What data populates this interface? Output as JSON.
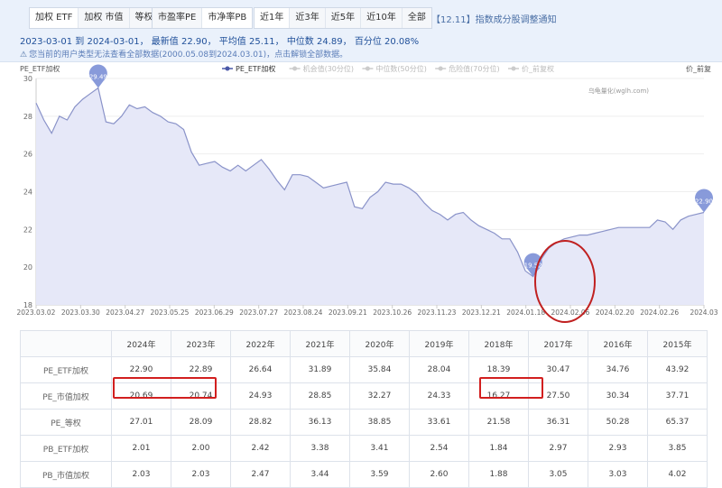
{
  "toolbar": {
    "group1": [
      "加权 ETF",
      "加权 市值",
      "等权"
    ],
    "group2": [
      "市盈率PE",
      "市净率PB"
    ],
    "group3": [
      "近1年",
      "近3年",
      "近5年",
      "近10年",
      "全部"
    ],
    "notice": "【12.11】指数成分股调整通知"
  },
  "info": {
    "range": "2023-03-01 到 2024-03-01",
    "latest_label": "最新值",
    "latest": "22.90",
    "avg_label": "平均值",
    "avg": "25.11",
    "median_label": "中位数",
    "median": "24.89",
    "pct_label": "百分位",
    "pct": "20.08%"
  },
  "warning": "您当前的用户类型无法查看全部数据(2000.05.08到2024.03.01)，点击解锁全部数据。",
  "chart_data": {
    "type": "area",
    "ylabel_left": "PE_ETF加权",
    "ylabel_right": "价_前复",
    "watermark": "乌龟量化(wglh.com)",
    "legend": [
      "PE_ETF加权",
      "机会值(30分位)",
      "中位数(50分位)",
      "危险值(70分位)",
      "价_前复权"
    ],
    "y_ticks": [
      "30",
      "28",
      "26",
      "24",
      "22",
      "20",
      "18"
    ],
    "ylim": [
      18,
      30
    ],
    "x_labels": [
      "2023.03.02",
      "2023.03.30",
      "2023.04.27",
      "2023.05.25",
      "2023.06.29",
      "2023.07.27",
      "2023.08.24",
      "2023.09.21",
      "2023.10.26",
      "2023.11.23",
      "2023.12.21",
      "2024.01.18",
      "2024.02.06",
      "2024.02.20",
      "2024.02.26",
      "2024.03"
    ],
    "values": [
      28.7,
      27.8,
      27.1,
      28.0,
      27.8,
      28.5,
      28.9,
      29.2,
      29.5,
      27.7,
      27.6,
      28.0,
      28.6,
      28.4,
      28.5,
      28.2,
      28.0,
      27.7,
      27.6,
      27.3,
      26.1,
      25.4,
      25.5,
      25.6,
      25.3,
      25.1,
      25.4,
      25.1,
      25.4,
      25.7,
      25.2,
      24.6,
      24.1,
      24.9,
      24.9,
      24.8,
      24.5,
      24.2,
      24.3,
      24.4,
      24.5,
      23.2,
      23.1,
      23.7,
      24.0,
      24.5,
      24.4,
      24.4,
      24.2,
      23.9,
      23.4,
      23.0,
      22.8,
      22.5,
      22.8,
      22.9,
      22.5,
      22.2,
      22.0,
      21.8,
      21.5,
      21.5,
      20.8,
      19.8,
      19.5,
      20.4,
      21.0,
      21.3,
      21.5,
      21.6,
      21.7,
      21.7,
      21.8,
      21.9,
      22.0,
      22.1,
      22.1,
      22.1,
      22.1,
      22.1,
      22.5,
      22.4,
      22.0,
      22.5,
      22.7,
      22.8,
      22.9
    ],
    "markers": [
      {
        "label": "29.49",
        "index": 8
      },
      {
        "label": "19.52",
        "index": 64
      },
      {
        "label": "22.90",
        "index": 86
      }
    ]
  },
  "table": {
    "headers": [
      "",
      "2024年",
      "2023年",
      "2022年",
      "2021年",
      "2020年",
      "2019年",
      "2018年",
      "2017年",
      "2016年",
      "2015年"
    ],
    "rows": [
      {
        "name": "PE_ETF加权",
        "cells": [
          "22.90",
          "22.89",
          "26.64",
          "31.89",
          "35.84",
          "28.04",
          "18.39",
          "30.47",
          "34.76",
          "43.92"
        ]
      },
      {
        "name": "PE_市值加权",
        "cells": [
          "20.69",
          "20.74",
          "24.93",
          "28.85",
          "32.27",
          "24.33",
          "16.27",
          "27.50",
          "30.34",
          "37.71"
        ]
      },
      {
        "name": "PE_等权",
        "cells": [
          "27.01",
          "28.09",
          "28.82",
          "36.13",
          "38.85",
          "33.61",
          "21.58",
          "36.31",
          "50.28",
          "65.37"
        ]
      },
      {
        "name": "PB_ETF加权",
        "cells": [
          "2.01",
          "2.00",
          "2.42",
          "3.38",
          "3.41",
          "2.54",
          "1.84",
          "2.97",
          "2.93",
          "3.85"
        ]
      },
      {
        "name": "PB_市值加权",
        "cells": [
          "2.03",
          "2.03",
          "2.47",
          "3.44",
          "3.59",
          "2.60",
          "1.88",
          "3.05",
          "3.03",
          "4.02"
        ]
      }
    ]
  },
  "colors": {
    "line": "#8a93c9",
    "fill": "#e6e8f8",
    "marker": "#7b8fd6",
    "highlight": "#d21f1f"
  }
}
